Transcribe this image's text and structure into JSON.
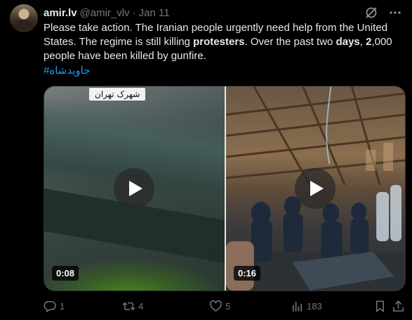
{
  "author": {
    "name": "amir.lv",
    "handle": "@amir_vlv",
    "separator": "·",
    "date": "Jan 11"
  },
  "tweet": {
    "t1": "Please take action. The Iranian people urgently need help from the United States. The regime is still killing ",
    "b1": "protesters",
    "t2": ". Over the past two ",
    "b2": "days",
    "t3": ", ",
    "b3": "2",
    "t4": ",000 people have been killed by gunfire.",
    "hashtag": "#جاویدشاه"
  },
  "media": {
    "left": {
      "caption": "شهرک تهران",
      "duration": "0:08"
    },
    "right": {
      "duration": "0:16"
    }
  },
  "actions": {
    "reply_count": "1",
    "repost_count": "4",
    "like_count": "5",
    "view_count": "183"
  },
  "icons": {
    "grok": "grok-icon",
    "more": "more-icon",
    "reply": "reply-icon",
    "repost": "repost-icon",
    "like": "heart-icon",
    "views": "views-icon",
    "bookmark": "bookmark-icon",
    "share": "share-icon"
  },
  "colors": {
    "background": "#000000",
    "text": "#e7e9ea",
    "muted": "#71767b",
    "link": "#1d9bf0"
  }
}
